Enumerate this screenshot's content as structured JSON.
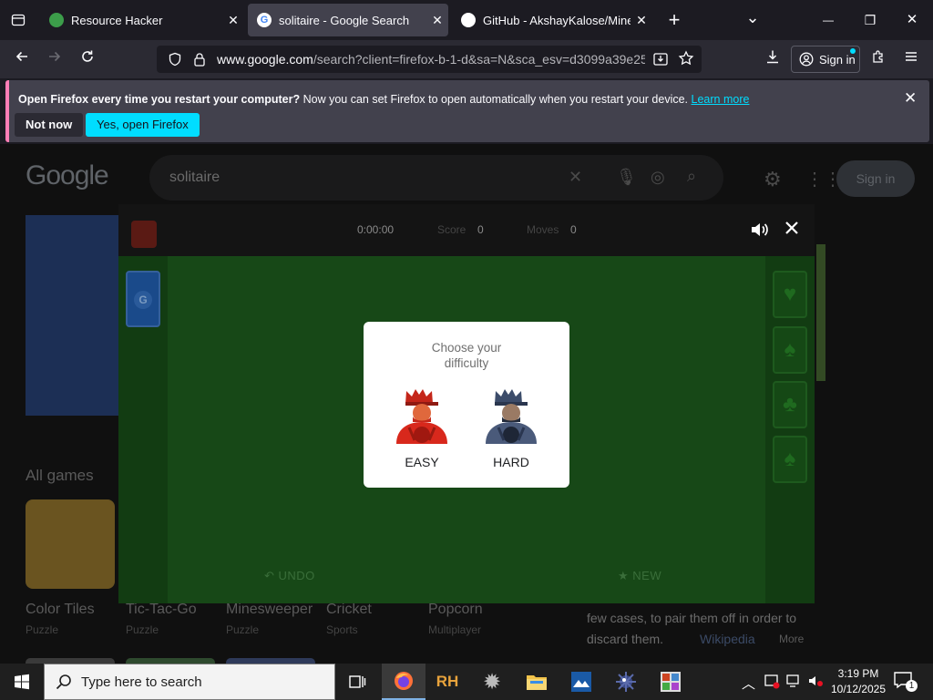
{
  "browser": {
    "tabs": [
      {
        "title": "Resource Hacker",
        "close": "✕",
        "favicon_color": "#3c9d4a"
      },
      {
        "title": "solitaire - Google Search",
        "close": "✕",
        "favicon_color": "#ffffff"
      },
      {
        "title": "GitHub - AkshayKalose/Minesw",
        "close": "✕",
        "favicon_color": "#ffffff"
      }
    ],
    "new_tab": "+",
    "list_all_tabs": "⌄",
    "window_controls": {
      "minimize": "—",
      "restore": "❐",
      "close": "✕"
    },
    "url": {
      "domain": "www.google.com",
      "rest": "/search?client=firefox-b-1-d&sa=N&sca_esv=d3099a39e25"
    },
    "sign_in_label": "Sign in"
  },
  "notification": {
    "bold_text": "Open Firefox every time you restart your computer?",
    "body_text": " Now you can set Firefox to open automatically when you restart your device. ",
    "link_text": "Learn more",
    "not_now": "Not now",
    "yes_open": "Yes, open Firefox"
  },
  "google": {
    "logo": "Google",
    "query": "solitaire",
    "sign_in": "Sign in",
    "all_games": "All games",
    "games": [
      {
        "name": "Color Tiles",
        "category": "Puzzle"
      },
      {
        "name": "Tic-Tac-Go",
        "category": "Puzzle"
      },
      {
        "name": "Minesweeper",
        "category": "Puzzle"
      },
      {
        "name": "Cricket",
        "category": "Sports"
      },
      {
        "name": "Popcorn",
        "category": "Multiplayer"
      }
    ],
    "snippet_line1": "few cases, to pair them off in order to",
    "snippet_line2": "discard them.",
    "snippet_source": "Wikipedia",
    "more": "More"
  },
  "solitaire": {
    "timer": "0:00:00",
    "score_label": "Score",
    "score_value": "0",
    "moves_label": "Moves",
    "moves_value": "0",
    "undo_label": "UNDO",
    "new_label": "NEW",
    "dialog_title": "Choose your difficulty",
    "easy_label": "EASY",
    "hard_label": "HARD"
  },
  "taskbar": {
    "search_placeholder": "Type here to search",
    "time": "3:19 PM",
    "date": "10/12/2025",
    "notification_count": "1"
  }
}
